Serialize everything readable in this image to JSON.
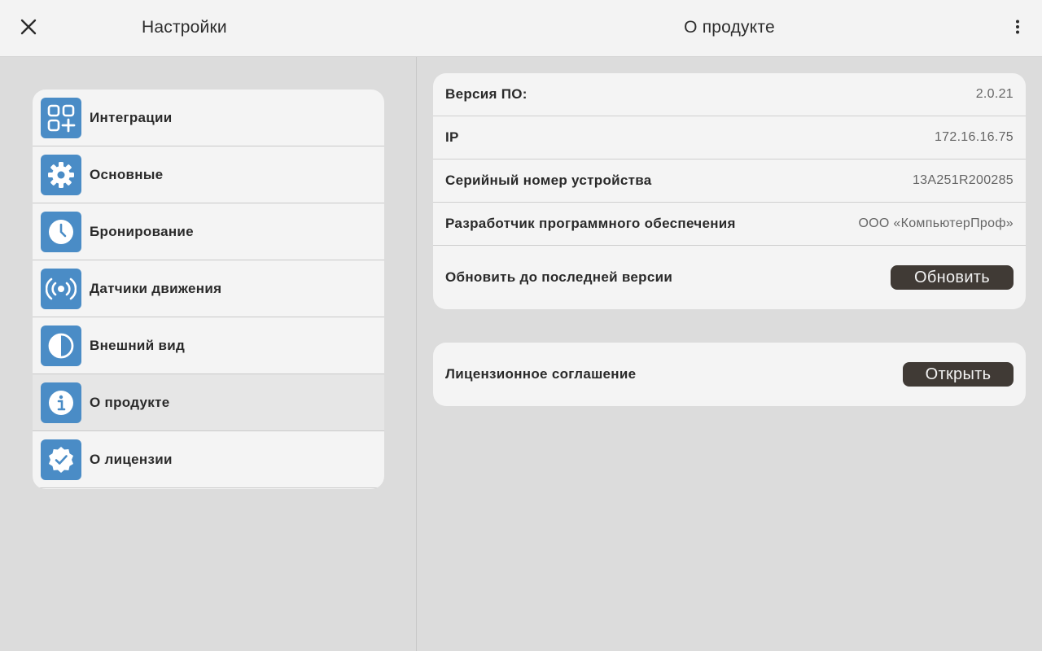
{
  "header": {
    "left_title": "Настройки",
    "center_title": "О продукте",
    "close_icon": "close-icon",
    "more_icon": "more-vertical-icon"
  },
  "colors": {
    "accent_icon_bg": "#4a8cc6",
    "button_dark": "#403a35",
    "background": "#dcdcdc",
    "card": "#f4f4f4"
  },
  "sidebar": {
    "items": [
      {
        "label": "Интеграции",
        "icon": "apps-add-icon",
        "active": false
      },
      {
        "label": "Основные",
        "icon": "gear-icon",
        "active": false
      },
      {
        "label": "Бронирование",
        "icon": "clock-icon",
        "active": false
      },
      {
        "label": "Датчики движения",
        "icon": "sensor-icon",
        "active": false
      },
      {
        "label": "Внешний вид",
        "icon": "contrast-icon",
        "active": false
      },
      {
        "label": "О продукте",
        "icon": "info-icon",
        "active": true
      },
      {
        "label": "О лицензии",
        "icon": "verified-badge-icon",
        "active": false
      }
    ]
  },
  "product": {
    "rows": [
      {
        "label": "Версия ПО:",
        "value": "2.0.21"
      },
      {
        "label": "IP",
        "value": "172.16.16.75"
      },
      {
        "label": "Серийный номер устройства",
        "value": "13A251R200285"
      },
      {
        "label": "Разработчик программного обеспечения",
        "value": "ООО «КомпьютерПроф»"
      }
    ],
    "update_label": "Обновить до последней версии",
    "update_button": "Обновить"
  },
  "license": {
    "label": "Лицензионное соглашение",
    "open_button": "Открыть"
  }
}
